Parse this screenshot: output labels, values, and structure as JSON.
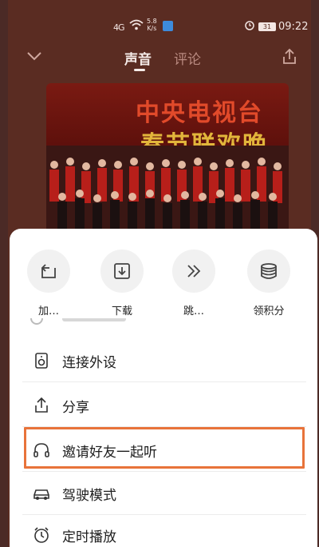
{
  "status_bar": {
    "signal": "4G",
    "speed_value": "5.8",
    "speed_unit": "K/s",
    "battery": "31",
    "time": "09:22"
  },
  "nav": {
    "tabs": [
      {
        "label": "声音",
        "active": true
      },
      {
        "label": "评论",
        "active": false
      }
    ]
  },
  "album": {
    "title_line1": "中央电视台",
    "title_line2": "春节联欢晚"
  },
  "sheet": {
    "actions": [
      {
        "label": "加…",
        "icon": "add-to-playlist-icon"
      },
      {
        "label": "下载",
        "icon": "download-icon"
      },
      {
        "label": "跳…",
        "icon": "skip-forward-icon"
      },
      {
        "label": "领积分",
        "icon": "coins-icon"
      }
    ],
    "menu": [
      {
        "label": "连接外设",
        "icon": "speaker-icon"
      },
      {
        "label": "分享",
        "icon": "share-icon"
      },
      {
        "label": "邀请好友一起听",
        "icon": "headphones-icon"
      },
      {
        "label": "驾驶模式",
        "icon": "car-icon"
      },
      {
        "label": "定时播放",
        "icon": "alarm-clock-icon"
      }
    ]
  },
  "colors": {
    "background": "#5a2c22",
    "highlight": "#e8733a",
    "sheet": "#ffffff"
  }
}
